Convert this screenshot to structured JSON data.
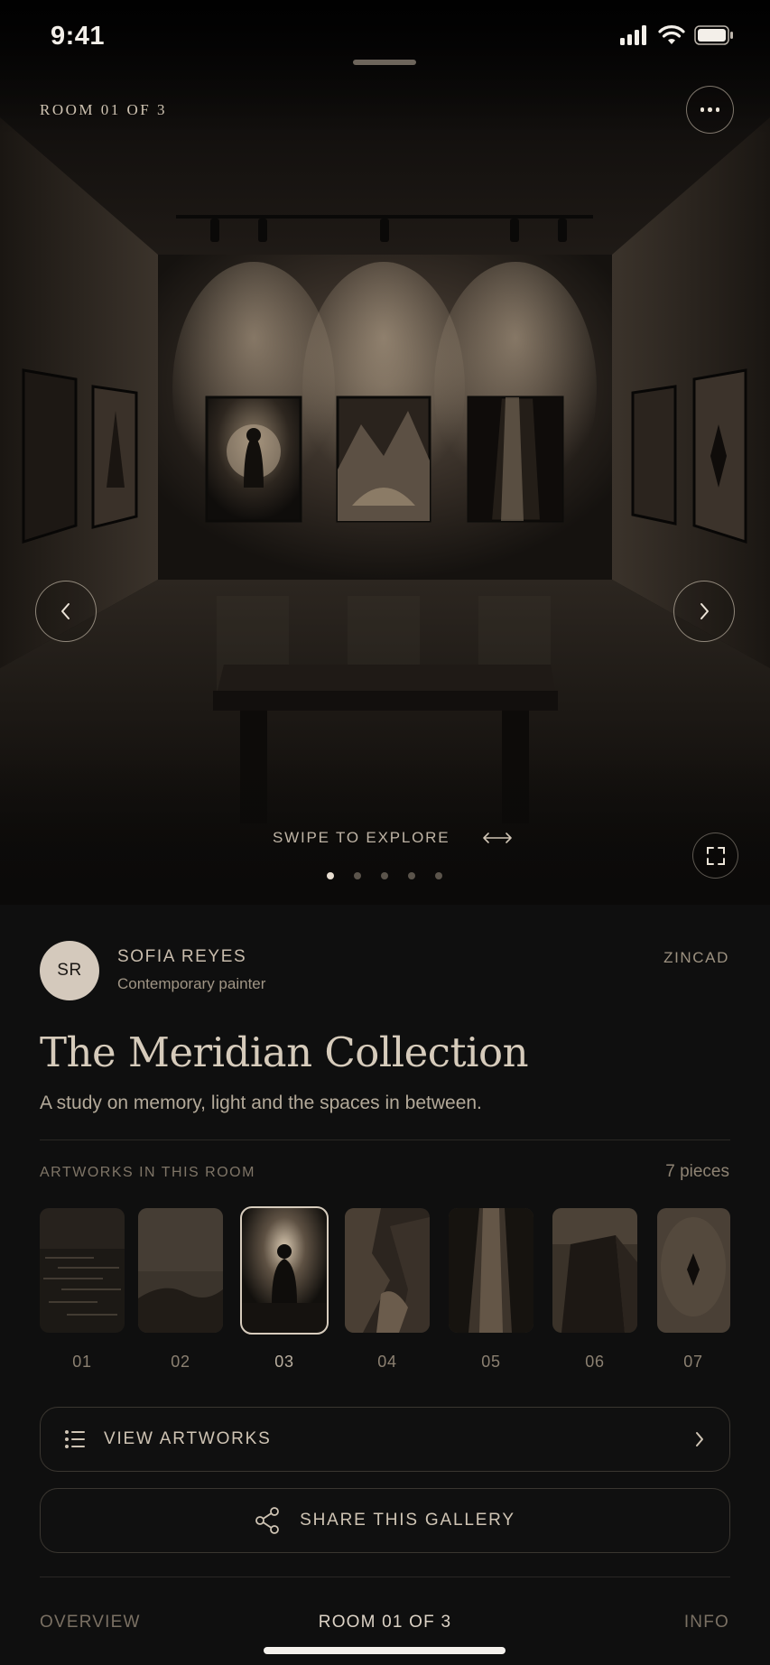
{
  "status": {
    "time": "9:41"
  },
  "hero": {
    "room_label": "ROOM 01 OF 3",
    "swipe_hint": "SWIPE TO EXPLORE",
    "page_count": 5,
    "active_page": 0
  },
  "artist": {
    "initials": "SR",
    "name": "SOFIA REYES",
    "role": "Contemporary painter"
  },
  "brand": "ZINCAD",
  "collection": {
    "title": "The Meridian Collection",
    "subtitle": "A study on memory, light and the spaces in between."
  },
  "artworks": {
    "section_label": "ARTWORKS IN THIS ROOM",
    "count_label": "7 pieces",
    "selected": "03",
    "items": [
      {
        "num": "01",
        "subject": "night sea"
      },
      {
        "num": "02",
        "subject": "misty landscape"
      },
      {
        "num": "03",
        "subject": "figure in light"
      },
      {
        "num": "04",
        "subject": "rocky cliffs"
      },
      {
        "num": "05",
        "subject": "canyon"
      },
      {
        "num": "06",
        "subject": "rock monolith"
      },
      {
        "num": "07",
        "subject": "abstract form"
      }
    ]
  },
  "actions": {
    "view_label": "VIEW ARTWORKS",
    "share_label": "SHARE THIS GALLERY"
  },
  "bottom_nav": {
    "overview": "OVERVIEW",
    "room": "ROOM 01 OF 3",
    "info": "INFO"
  },
  "colors": {
    "background": "#0f0f0f",
    "accent": "#d6cbbb",
    "muted": "#7f7567"
  },
  "icons": {
    "more": "more-horizontal-icon",
    "prev": "chevron-left-icon",
    "next": "chevron-right-icon",
    "swipe": "arrows-horizontal-icon",
    "fullscreen": "fullscreen-icon",
    "list": "list-icon",
    "share": "share-icon"
  }
}
